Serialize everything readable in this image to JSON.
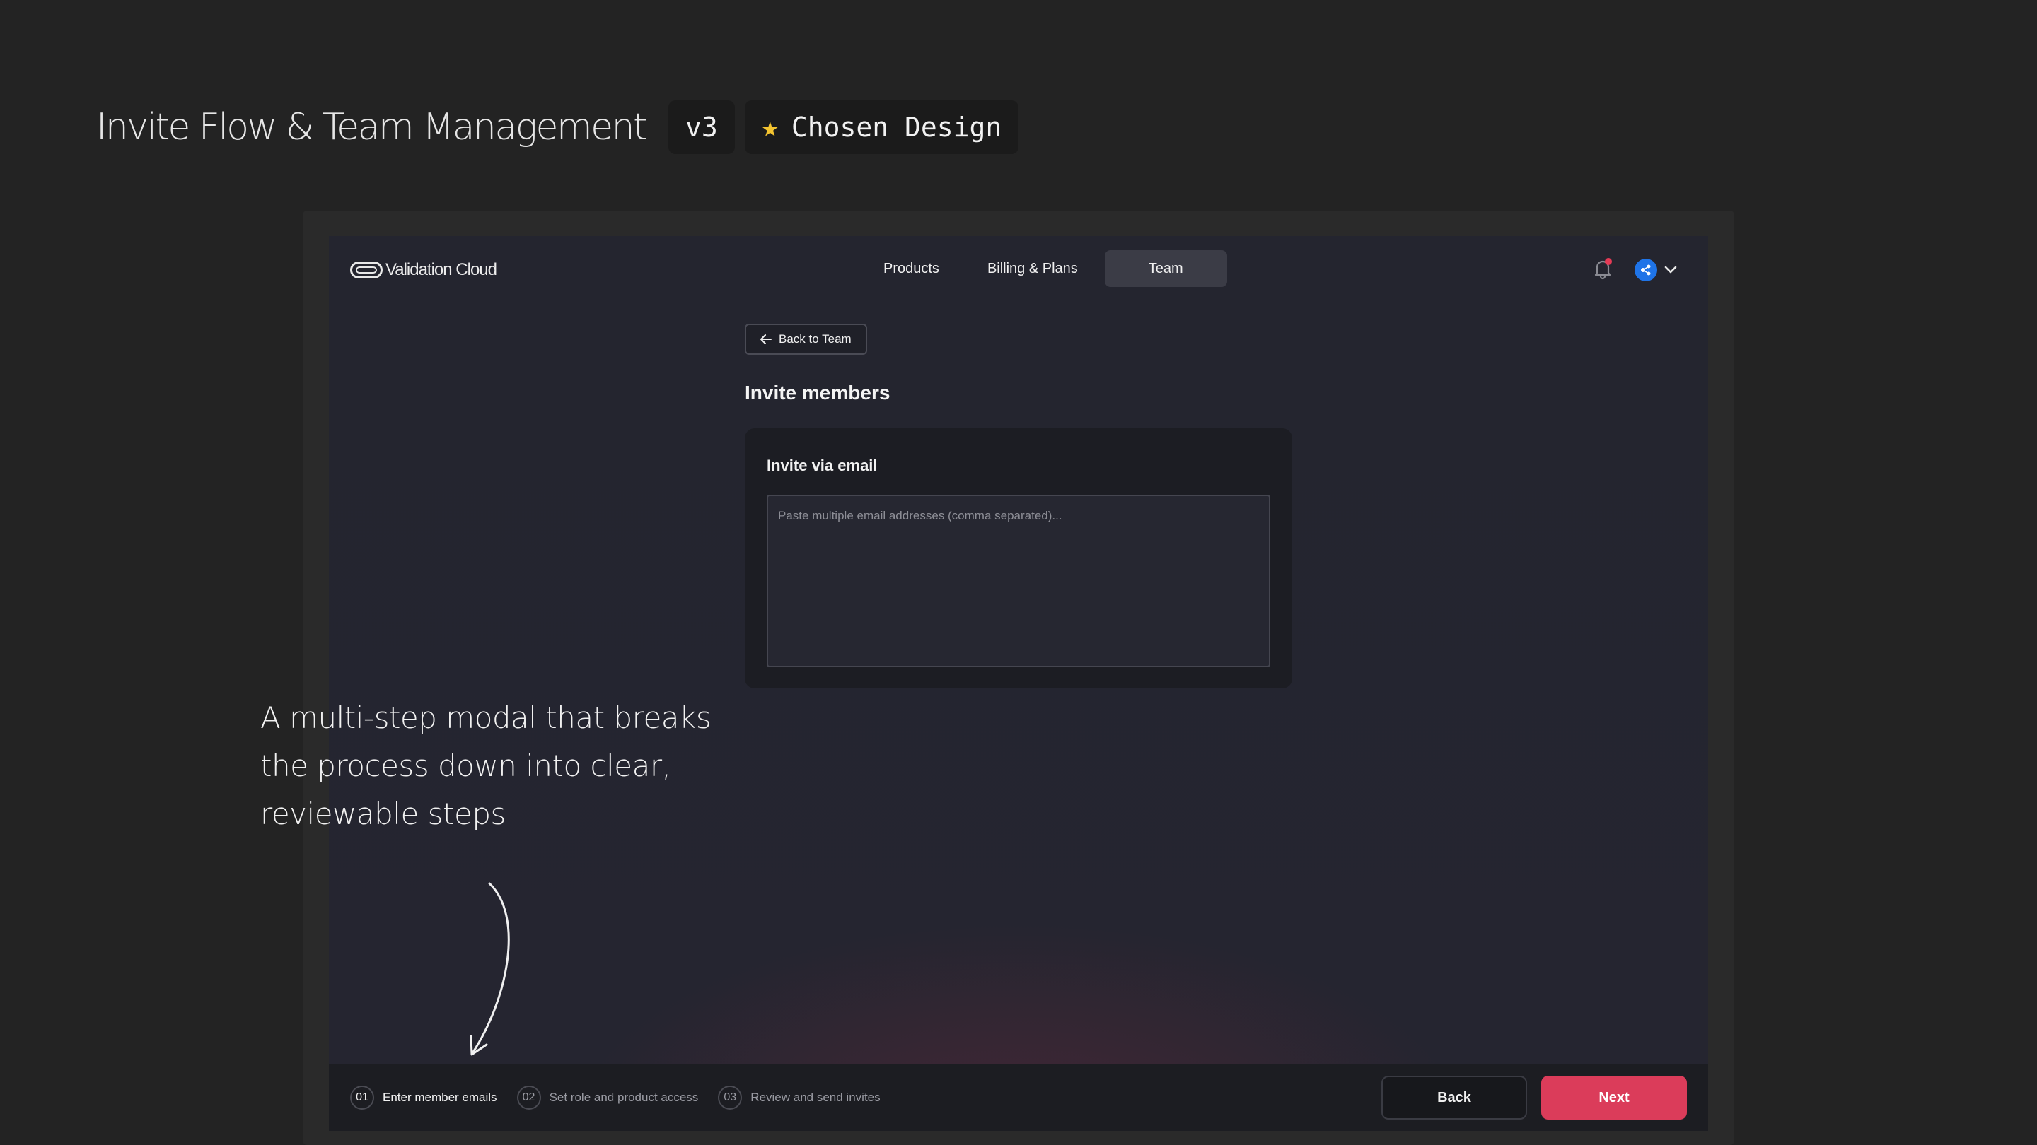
{
  "presentation": {
    "title": "Invite Flow & Team Management",
    "version_badge": "v3",
    "chosen_badge": "Chosen Design",
    "annotation": "A multi-step modal that breaks the process down into clear, reviewable steps"
  },
  "app": {
    "logo_text": "Validation Cloud",
    "nav": [
      {
        "label": "Products",
        "active": false
      },
      {
        "label": "Billing & Plans",
        "active": false
      },
      {
        "label": "Team",
        "active": true
      }
    ],
    "notification_dot_color": "#e53a55",
    "avatar_color": "#1f74e8"
  },
  "content": {
    "back_button": "Back to Team",
    "page_title": "Invite members",
    "card_title": "Invite via email",
    "email_placeholder": "Paste multiple email addresses (comma separated)..."
  },
  "footer": {
    "steps": [
      {
        "num": "01",
        "label": "Enter member emails",
        "active": true
      },
      {
        "num": "02",
        "label": "Set role and product access",
        "active": false
      },
      {
        "num": "03",
        "label": "Review and send invites",
        "active": false
      }
    ],
    "back_label": "Back",
    "next_label": "Next",
    "next_color": "#db3c5a"
  }
}
